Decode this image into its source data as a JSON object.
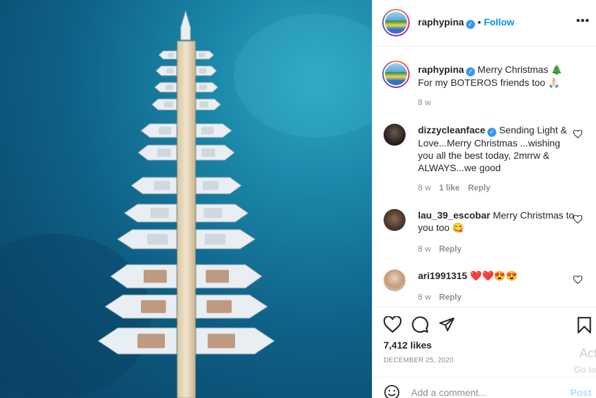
{
  "post": {
    "username": "raphypina",
    "follow_label": "Follow",
    "more_label": "•••",
    "caption_user": "raphypina",
    "caption_text": "Merry Christmas 🎄 For my BOTEROS friends too 🙏🏻",
    "caption_time": "8 w",
    "likes": "7,412 likes",
    "date": "DECEMBER 25, 2020",
    "add_comment_placeholder": "Add a comment...",
    "post_label": "Post"
  },
  "comments": [
    {
      "user": "dizzycleanface",
      "verified": true,
      "text": "Sending Light & Love...Merry Christmas ...wishing you all the best today, 2mrrw & ALWAYS...we good",
      "time": "8 w",
      "likes": "1 like",
      "reply": "Reply"
    },
    {
      "user": "lau_39_escobar",
      "verified": false,
      "text": "Merry Christmas to you too 😋",
      "time": "8 w",
      "reply": "Reply"
    },
    {
      "user": "ari1991315",
      "verified": false,
      "text": "❤️❤️😍😍",
      "time": "8 w",
      "reply": "Reply"
    }
  ],
  "watermark": {
    "line1": "Acti",
    "line2": "Go to"
  },
  "icons": [
    "verified-badge-icon",
    "heart-icon",
    "comment-icon",
    "share-icon",
    "bookmark-icon",
    "emoji-icon"
  ],
  "colors": {
    "accent": "#0095f6",
    "muted": "#8e8e8e",
    "text": "#262626",
    "sea": "#0f6187"
  }
}
